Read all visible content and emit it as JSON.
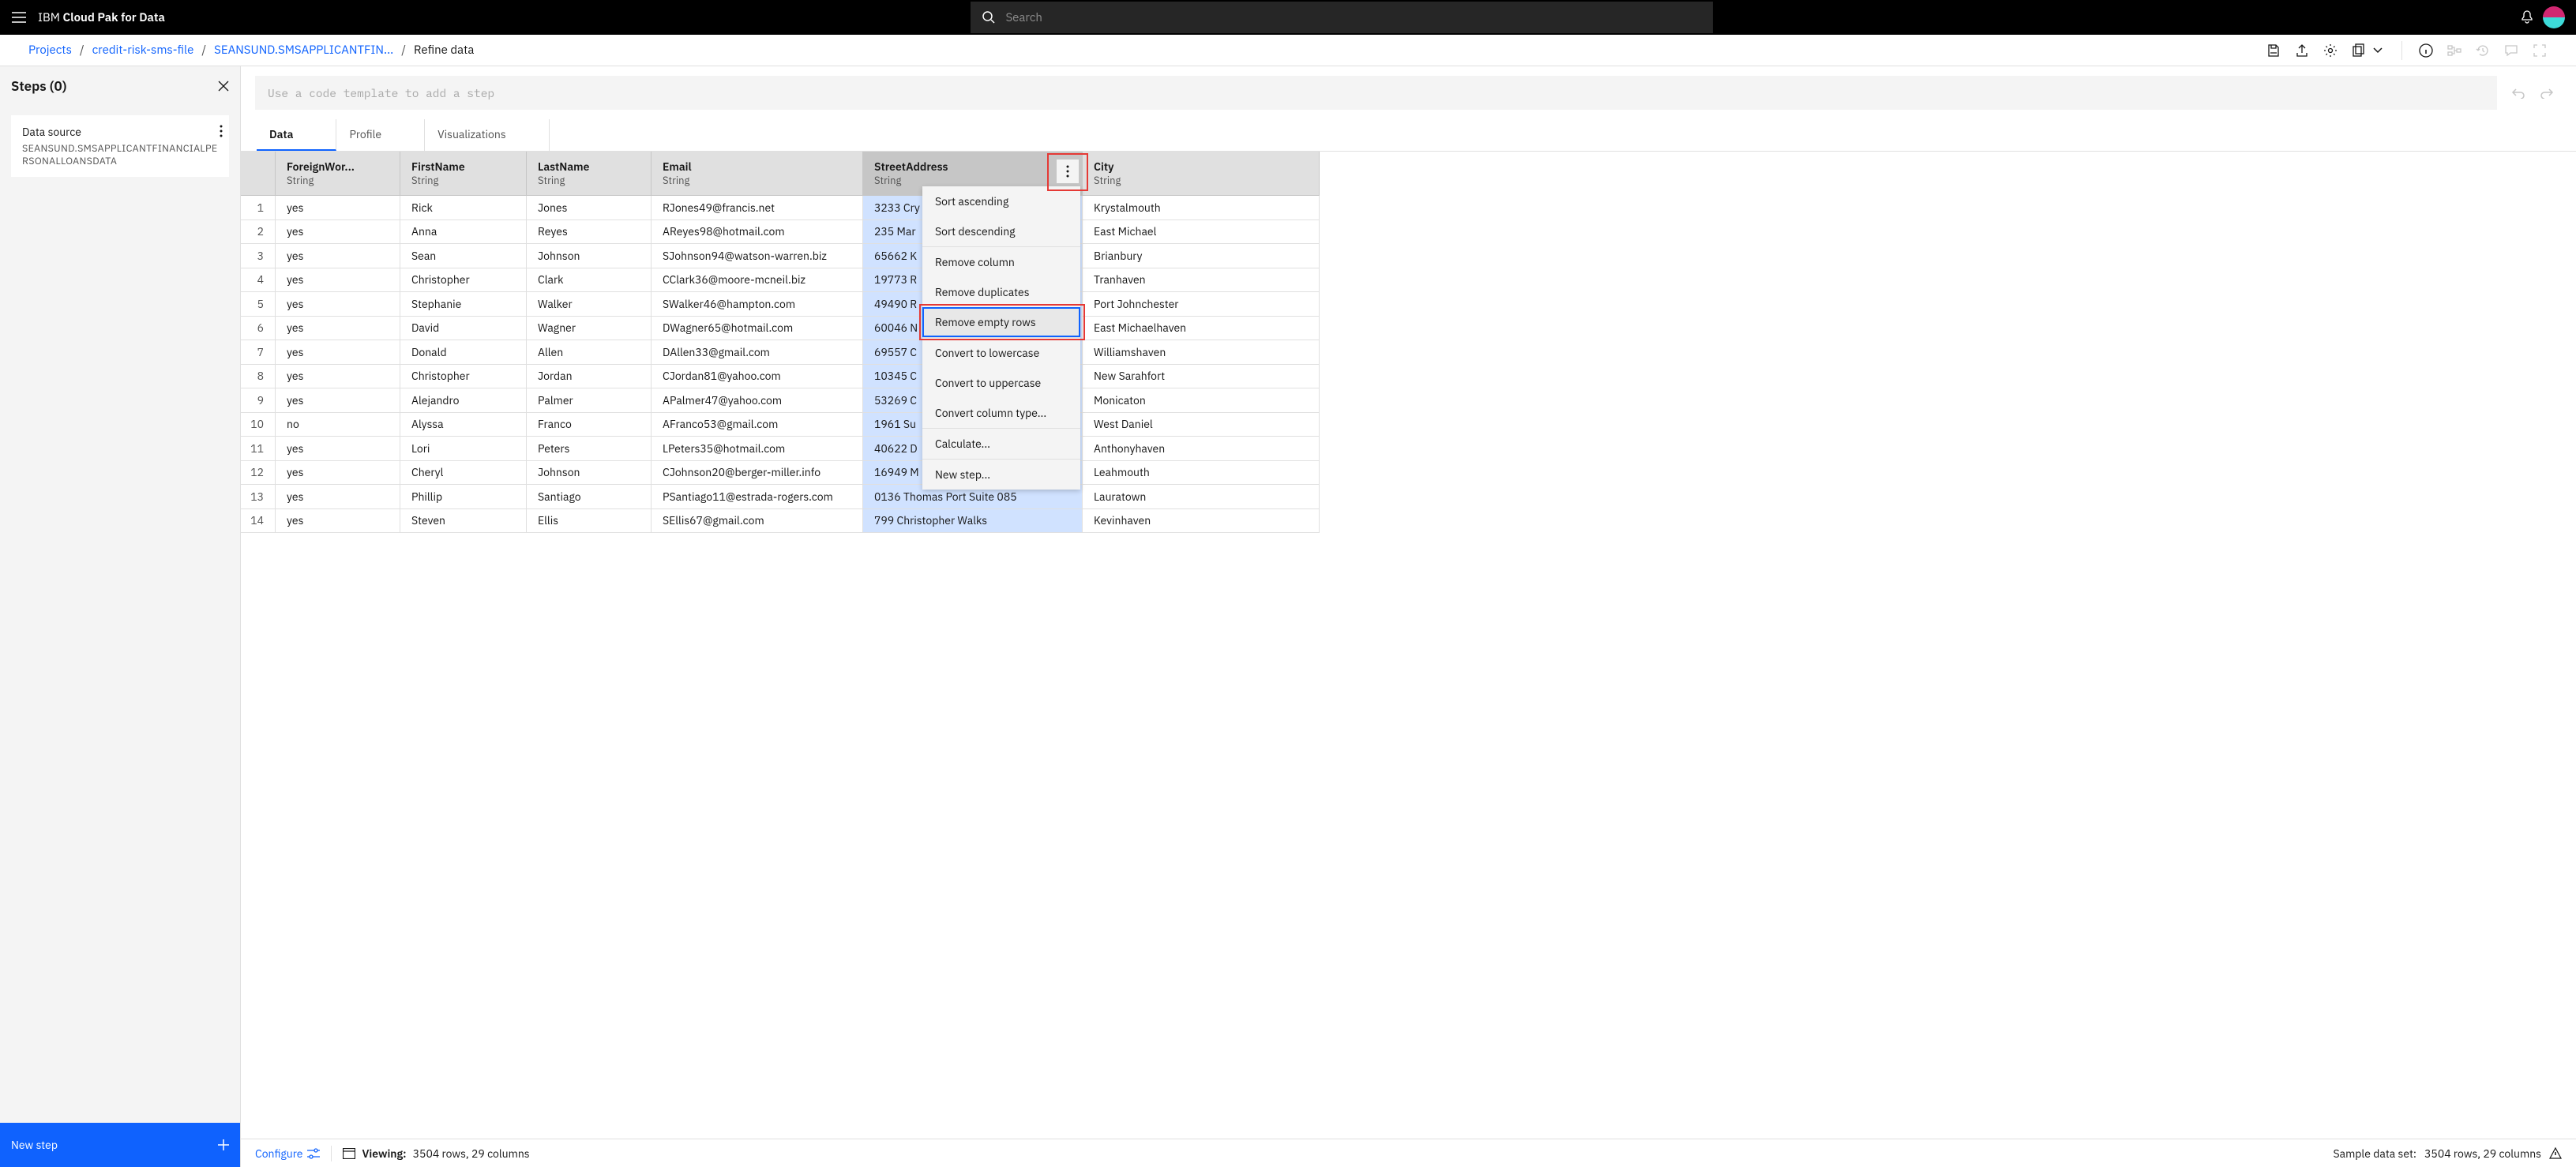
{
  "brand": {
    "ibm": "IBM",
    "rest": "Cloud Pak for Data"
  },
  "search": {
    "placeholder": "Search"
  },
  "breadcrumb": {
    "projects": "Projects",
    "project": "credit-risk-sms-file",
    "asset": "SEANSUND.SMSAPPLICANTFIN...",
    "current": "Refine data"
  },
  "sidebar": {
    "steps_title": "Steps (0)",
    "data_source_label": "Data source",
    "data_source_value": "SEANSUND.SMSAPPLICANTFINANCIALPERSONALLOANSDATA",
    "new_step": "New step"
  },
  "code_input": {
    "placeholder": "Use a code template to add a step"
  },
  "tabs": {
    "data": "Data",
    "profile": "Profile",
    "visualizations": "Visualizations"
  },
  "columns": [
    {
      "name": "ForeignWor...",
      "type": "String",
      "highlight": false
    },
    {
      "name": "FirstName",
      "type": "String",
      "highlight": false
    },
    {
      "name": "LastName",
      "type": "String",
      "highlight": false
    },
    {
      "name": "Email",
      "type": "String",
      "highlight": false
    },
    {
      "name": "StreetAddress",
      "type": "String",
      "highlight": true
    },
    {
      "name": "City",
      "type": "String",
      "highlight": false
    }
  ],
  "rows": [
    {
      "n": "1",
      "ForeignWorker": "yes",
      "FirstName": "Rick",
      "LastName": "Jones",
      "Email": "RJones49@francis.net",
      "StreetAddress": "3233 Cry",
      "City": "Krystalmouth"
    },
    {
      "n": "2",
      "ForeignWorker": "yes",
      "FirstName": "Anna",
      "LastName": "Reyes",
      "Email": "AReyes98@hotmail.com",
      "StreetAddress": "235 Mar",
      "City": "East Michael"
    },
    {
      "n": "3",
      "ForeignWorker": "yes",
      "FirstName": "Sean",
      "LastName": "Johnson",
      "Email": "SJohnson94@watson-warren.biz",
      "StreetAddress": "65662 K",
      "City": "Brianbury"
    },
    {
      "n": "4",
      "ForeignWorker": "yes",
      "FirstName": "Christopher",
      "LastName": "Clark",
      "Email": "CClark36@moore-mcneil.biz",
      "StreetAddress": "19773 R",
      "City": "Tranhaven"
    },
    {
      "n": "5",
      "ForeignWorker": "yes",
      "FirstName": "Stephanie",
      "LastName": "Walker",
      "Email": "SWalker46@hampton.com",
      "StreetAddress": "49490 R",
      "City": "Port Johnchester"
    },
    {
      "n": "6",
      "ForeignWorker": "yes",
      "FirstName": "David",
      "LastName": "Wagner",
      "Email": "DWagner65@hotmail.com",
      "StreetAddress": "60046 N",
      "City": "East Michaelhaven"
    },
    {
      "n": "7",
      "ForeignWorker": "yes",
      "FirstName": "Donald",
      "LastName": "Allen",
      "Email": "DAllen33@gmail.com",
      "StreetAddress": "69557 C",
      "City": "Williamshaven"
    },
    {
      "n": "8",
      "ForeignWorker": "yes",
      "FirstName": "Christopher",
      "LastName": "Jordan",
      "Email": "CJordan81@yahoo.com",
      "StreetAddress": "10345 C",
      "City": "New Sarahfort"
    },
    {
      "n": "9",
      "ForeignWorker": "yes",
      "FirstName": "Alejandro",
      "LastName": "Palmer",
      "Email": "APalmer47@yahoo.com",
      "StreetAddress": "53269 C",
      "City": "Monicaton"
    },
    {
      "n": "10",
      "ForeignWorker": "no",
      "FirstName": "Alyssa",
      "LastName": "Franco",
      "Email": "AFranco53@gmail.com",
      "StreetAddress": "1961 Su",
      "City": "West Daniel"
    },
    {
      "n": "11",
      "ForeignWorker": "yes",
      "FirstName": "Lori",
      "LastName": "Peters",
      "Email": "LPeters35@hotmail.com",
      "StreetAddress": "40622 D",
      "City": "Anthonyhaven"
    },
    {
      "n": "12",
      "ForeignWorker": "yes",
      "FirstName": "Cheryl",
      "LastName": "Johnson",
      "Email": "CJohnson20@berger-miller.info",
      "StreetAddress": "16949 M",
      "City": "Leahmouth"
    },
    {
      "n": "13",
      "ForeignWorker": "yes",
      "FirstName": "Phillip",
      "LastName": "Santiago",
      "Email": "PSantiago11@estrada-rogers.com",
      "StreetAddress": "0136 Thomas Port Suite 085",
      "City": "Lauratown"
    },
    {
      "n": "14",
      "ForeignWorker": "yes",
      "FirstName": "Steven",
      "LastName": "Ellis",
      "Email": "SEllis67@gmail.com",
      "StreetAddress": "799 Christopher Walks",
      "City": "Kevinhaven"
    }
  ],
  "col_menu": {
    "sort_asc": "Sort ascending",
    "sort_desc": "Sort descending",
    "remove_col": "Remove column",
    "remove_dup": "Remove duplicates",
    "remove_empty": "Remove empty rows",
    "to_lower": "Convert to lowercase",
    "to_upper": "Convert to uppercase",
    "convert_type": "Convert column type...",
    "calculate": "Calculate...",
    "new_step": "New step..."
  },
  "footer": {
    "configure": "Configure",
    "viewing_label": "Viewing:",
    "viewing_value": "3504 rows, 29 columns",
    "sample_label": "Sample data set:",
    "sample_value": "3504 rows, 29 columns"
  }
}
